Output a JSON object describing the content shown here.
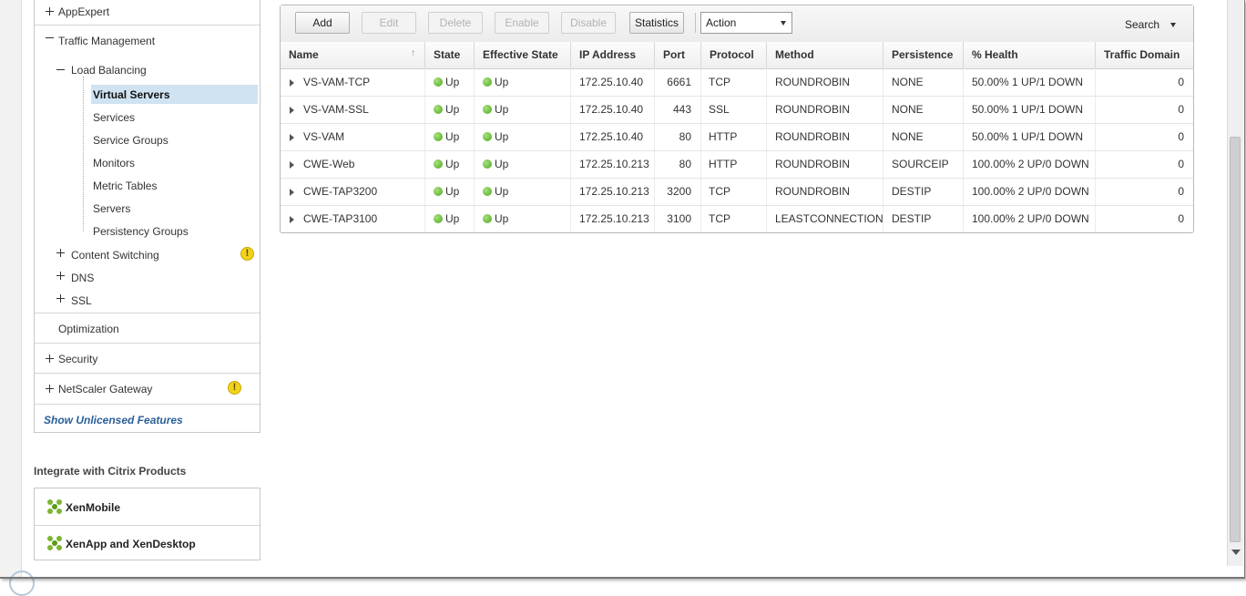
{
  "sidebar": {
    "items": {
      "appexpert": "AppExpert",
      "traffic_management": "Traffic Management",
      "load_balancing": "Load Balancing",
      "virtual_servers": "Virtual Servers",
      "services": "Services",
      "service_groups": "Service Groups",
      "monitors": "Monitors",
      "metric_tables": "Metric Tables",
      "servers": "Servers",
      "persistency_groups": "Persistency Groups",
      "content_switching": "Content Switching",
      "dns": "DNS",
      "ssl": "SSL",
      "optimization": "Optimization",
      "security": "Security",
      "netscaler_gateway": "NetScaler Gateway"
    },
    "warning_symbol": "!",
    "show_unlicensed": "Show Unlicensed Features"
  },
  "integrate": {
    "title": "Integrate with Citrix Products",
    "products": [
      "XenMobile",
      "XenApp and XenDesktop"
    ]
  },
  "toolbar": {
    "add": "Add",
    "edit": "Edit",
    "delete": "Delete",
    "enable": "Enable",
    "disable": "Disable",
    "statistics": "Statistics",
    "action": "Action",
    "search": "Search"
  },
  "table": {
    "columns": [
      "Name",
      "State",
      "Effective State",
      "IP Address",
      "Port",
      "Protocol",
      "Method",
      "Persistence",
      "% Health",
      "Traffic Domain"
    ],
    "rows": [
      {
        "name": "VS-VAM-TCP",
        "state": "Up",
        "effective_state": "Up",
        "ip": "172.25.10.40",
        "port": "6661",
        "protocol": "TCP",
        "method": "ROUNDROBIN",
        "persistence": "NONE",
        "health": "50.00% 1 UP/1 DOWN",
        "traffic_domain": "0"
      },
      {
        "name": "VS-VAM-SSL",
        "state": "Up",
        "effective_state": "Up",
        "ip": "172.25.10.40",
        "port": "443",
        "protocol": "SSL",
        "method": "ROUNDROBIN",
        "persistence": "NONE",
        "health": "50.00% 1 UP/1 DOWN",
        "traffic_domain": "0"
      },
      {
        "name": "VS-VAM",
        "state": "Up",
        "effective_state": "Up",
        "ip": "172.25.10.40",
        "port": "80",
        "protocol": "HTTP",
        "method": "ROUNDROBIN",
        "persistence": "NONE",
        "health": "50.00% 1 UP/1 DOWN",
        "traffic_domain": "0"
      },
      {
        "name": "CWE-Web",
        "state": "Up",
        "effective_state": "Up",
        "ip": "172.25.10.213",
        "port": "80",
        "protocol": "HTTP",
        "method": "ROUNDROBIN",
        "persistence": "SOURCEIP",
        "health": "100.00% 2 UP/0 DOWN",
        "traffic_domain": "0"
      },
      {
        "name": "CWE-TAP3200",
        "state": "Up",
        "effective_state": "Up",
        "ip": "172.25.10.213",
        "port": "3200",
        "protocol": "TCP",
        "method": "ROUNDROBIN",
        "persistence": "DESTIP",
        "health": "100.00% 2 UP/0 DOWN",
        "traffic_domain": "0"
      },
      {
        "name": "CWE-TAP3100",
        "state": "Up",
        "effective_state": "Up",
        "ip": "172.25.10.213",
        "port": "3100",
        "protocol": "TCP",
        "method": "LEASTCONNECTION",
        "persistence": "DESTIP",
        "health": "100.00% 2 UP/0 DOWN",
        "traffic_domain": "0"
      }
    ]
  },
  "colors": {
    "selected": "#cfe3f2",
    "link": "#2a5f99",
    "status_up": "#4aa81e",
    "warning": "#f2d21a"
  }
}
